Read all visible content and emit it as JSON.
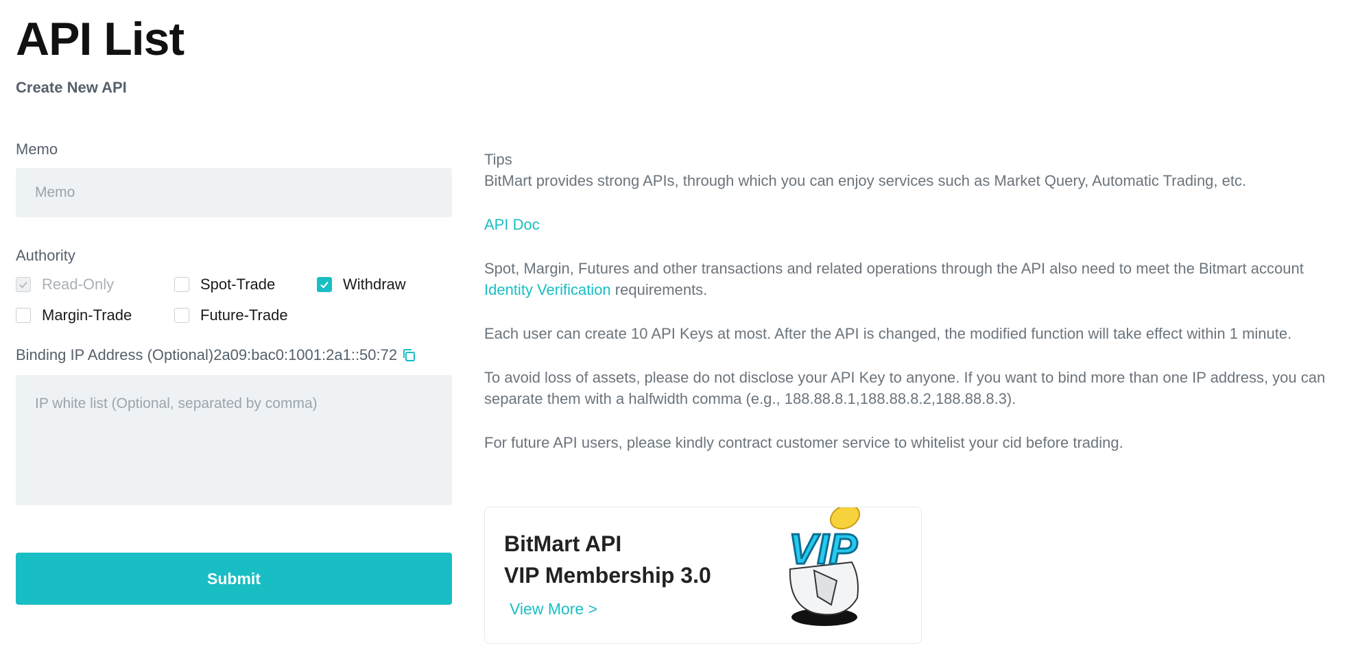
{
  "page": {
    "title": "API List",
    "subtitle": "Create New API"
  },
  "form": {
    "memo_label": "Memo",
    "memo_placeholder": "Memo",
    "authority_label": "Authority",
    "authorities": {
      "read_only": {
        "label": "Read-Only",
        "checked": true,
        "disabled": true
      },
      "spot_trade": {
        "label": "Spot-Trade",
        "checked": false
      },
      "withdraw": {
        "label": "Withdraw",
        "checked": true
      },
      "margin_trade": {
        "label": "Margin-Trade",
        "checked": false
      },
      "future_trade": {
        "label": "Future-Trade",
        "checked": false
      }
    },
    "ip_label": "Binding IP Address (Optional)",
    "ip_value": "2a09:bac0:1001:2a1::50:72",
    "ip_placeholder": "IP white list (Optional, separated by comma)",
    "submit_label": "Submit"
  },
  "tips": {
    "heading": "Tips",
    "intro": "BitMart provides strong APIs, through which you can enjoy services such as Market Query, Automatic Trading, etc.",
    "api_doc_link": "API Doc",
    "verification_before": "Spot, Margin, Futures and other transactions and related operations through the API also need to meet the Bitmart account ",
    "verification_link": "Identity Verification",
    "verification_after": " requirements.",
    "limit_text": "Each user can create 10 API Keys at most. After the API is changed, the modified function will take effect within 1 minute.",
    "security_text": "To avoid loss of assets, please do not disclose your API Key to anyone. If you want to bind more than one IP address, you can separate them with a halfwidth comma (e.g., 188.88.8.1,188.88.8.2,188.88.8.3).",
    "futures_text": "For future API users, please kindly contract customer service to whitelist your cid before trading."
  },
  "vip_card": {
    "title_line1": "BitMart API",
    "title_line2": "VIP Membership 3.0",
    "link": "View More >",
    "badge_text": "VIP"
  },
  "colors": {
    "accent": "#18bec3",
    "input_bg": "#eef2f5",
    "muted_text": "#6b747c"
  }
}
